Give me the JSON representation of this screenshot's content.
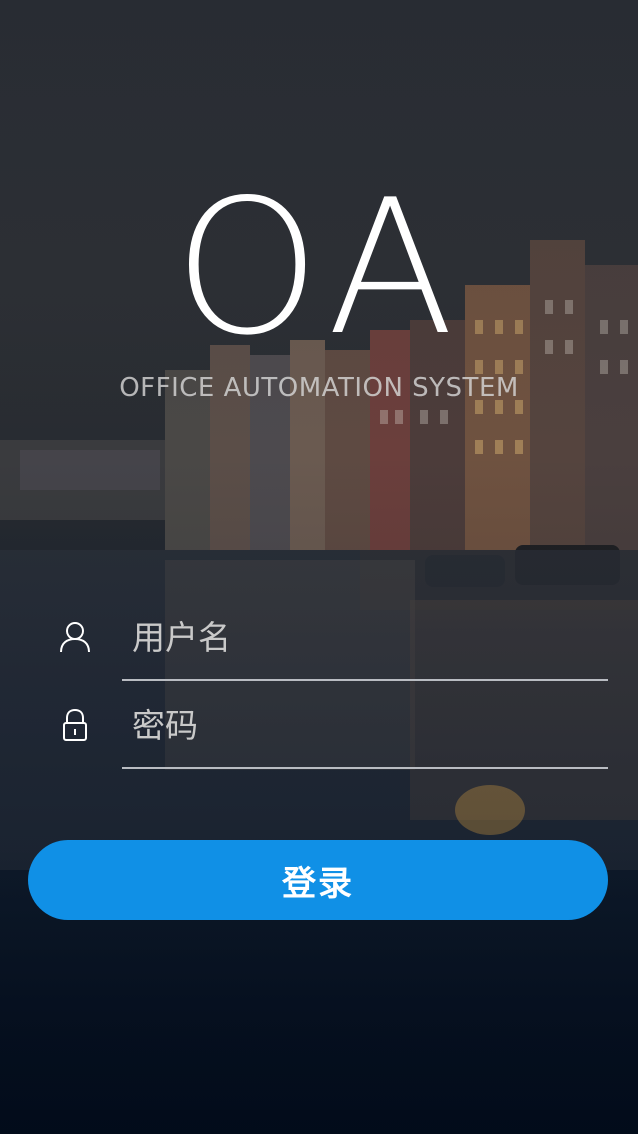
{
  "logo": {
    "title": "OA",
    "subtitle": "OFFICE AUTOMATION SYSTEM"
  },
  "form": {
    "username": {
      "placeholder": "用户名",
      "value": "",
      "icon": "user-icon"
    },
    "password": {
      "placeholder": "密码",
      "value": "",
      "icon": "lock-icon"
    },
    "login_label": "登录"
  },
  "colors": {
    "accent": "#1090e6",
    "text": "#ffffff",
    "underline": "#b9bcc2"
  }
}
